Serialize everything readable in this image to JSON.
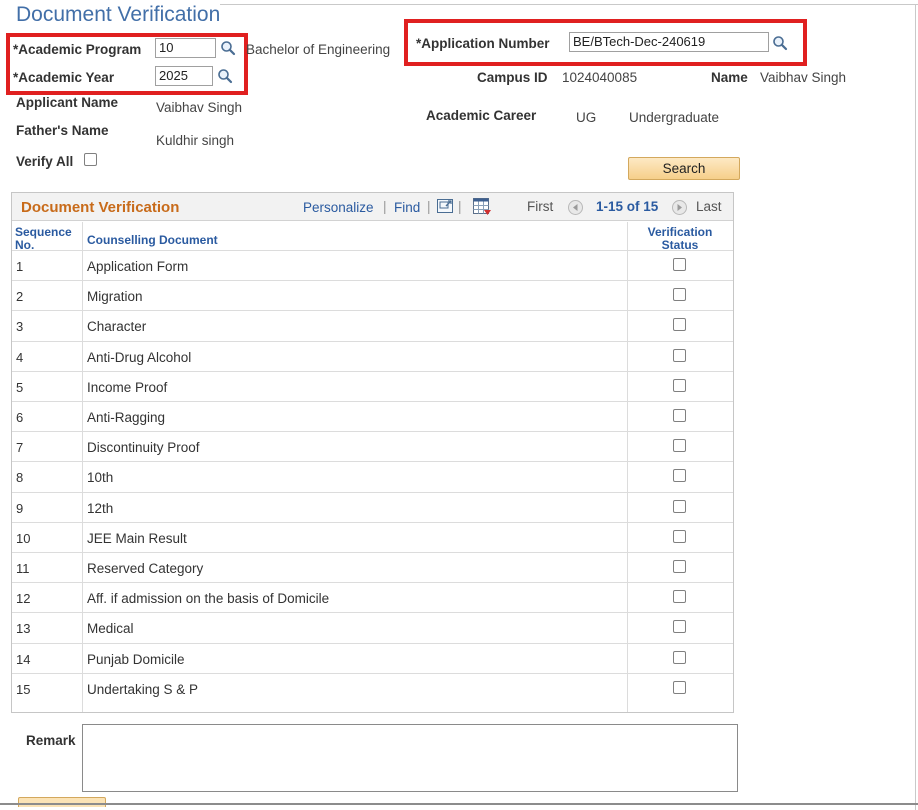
{
  "page": {
    "title": "Document Verification"
  },
  "form": {
    "academic_program": {
      "label": "*Academic Program",
      "value": "10",
      "description": "Bachelor of Engineering"
    },
    "academic_year": {
      "label": "*Academic Year",
      "value": "2025"
    },
    "application_number": {
      "label": "*Application Number",
      "value": "BE/BTech-Dec-240619"
    },
    "campus_id": {
      "label": "Campus ID",
      "value": "1024040085"
    },
    "name": {
      "label": "Name",
      "value": "Vaibhav Singh"
    },
    "applicant_name": {
      "label": "Applicant Name",
      "value": "Vaibhav Singh"
    },
    "academic_career": {
      "label": "Academic Career",
      "code": "UG",
      "description": "Undergraduate"
    },
    "fathers_name": {
      "label": "Father's Name",
      "value": "Kuldhir singh"
    },
    "verify_all": {
      "label": "Verify All",
      "checked": false
    },
    "search_button": "Search"
  },
  "grid": {
    "title": "Document Verification",
    "personalize": "Personalize",
    "find": "Find",
    "first": "First",
    "range": "1-15 of 15",
    "last": "Last",
    "columns": {
      "seq_line1": "Sequence",
      "seq_line2": "No.",
      "document": "Counselling Document",
      "status_line1": "Verification",
      "status_line2": "Status"
    },
    "rows": [
      {
        "seq": "1",
        "doc": "Application Form",
        "checked": false
      },
      {
        "seq": "2",
        "doc": "Migration",
        "checked": false
      },
      {
        "seq": "3",
        "doc": "Character",
        "checked": false
      },
      {
        "seq": "4",
        "doc": "Anti-Drug Alcohol",
        "checked": false
      },
      {
        "seq": "5",
        "doc": "Income Proof",
        "checked": false
      },
      {
        "seq": "6",
        "doc": "Anti-Ragging",
        "checked": false
      },
      {
        "seq": "7",
        "doc": "Discontinuity Proof",
        "checked": false
      },
      {
        "seq": "8",
        "doc": "10th",
        "checked": false
      },
      {
        "seq": "9",
        "doc": "12th",
        "checked": false
      },
      {
        "seq": "10",
        "doc": "JEE Main Result",
        "checked": false
      },
      {
        "seq": "11",
        "doc": "Reserved Category",
        "checked": false
      },
      {
        "seq": "12",
        "doc": "Aff. if admission on the basis of Domicile",
        "checked": false
      },
      {
        "seq": "13",
        "doc": "Medical",
        "checked": false
      },
      {
        "seq": "14",
        "doc": "Punjab Domicile",
        "checked": false
      },
      {
        "seq": "15",
        "doc": "Undertaking S & P",
        "checked": false
      }
    ]
  },
  "remark": {
    "label": "Remark",
    "value": ""
  },
  "icons": {
    "lookup": "magnifier-icon",
    "grid_zoom": "zoom-grid-icon",
    "download": "download-to-excel-icon",
    "prev": "prev-arrow-icon",
    "next": "next-arrow-icon"
  },
  "colors": {
    "title": "#426fa8",
    "grid_title": "#c86b1a",
    "link": "#2a5aa0",
    "highlight": "#e02020",
    "button": "#f6cf8a"
  }
}
